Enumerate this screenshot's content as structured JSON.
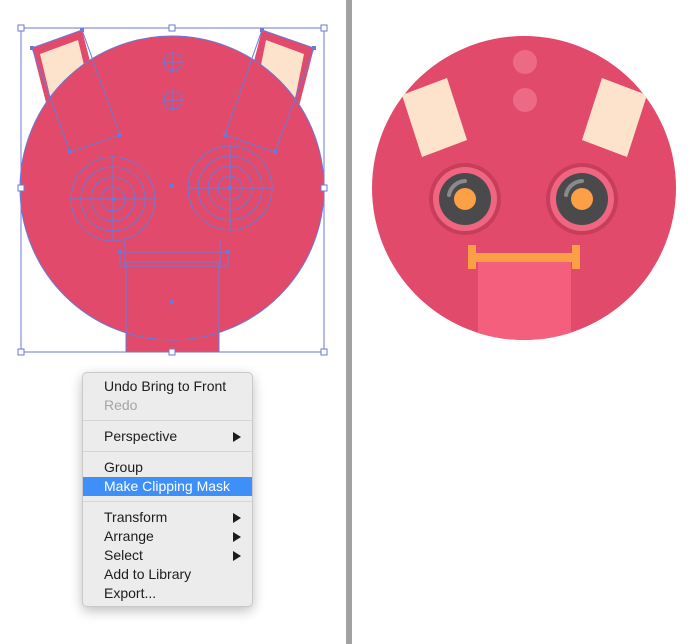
{
  "colors": {
    "face": "#e14a6a",
    "ear": "#fde3cc",
    "dot": "#ed6a86",
    "eye_ring": "#f06582",
    "eye_ring_dark": "#c63e5a",
    "pupil": "#4a4a4c",
    "iris": "#fca046",
    "mouth_bar": "#fca046",
    "tongue": "#f45f7e",
    "selection": "#6b79d8",
    "menu_highlight": "#3e8ff7"
  },
  "context_menu": {
    "items": [
      {
        "label": "Undo Bring to Front",
        "enabled": true,
        "submenu": false,
        "highlighted": false
      },
      {
        "label": "Redo",
        "enabled": false,
        "submenu": false,
        "highlighted": false
      },
      {
        "separator": true
      },
      {
        "label": "Perspective",
        "enabled": true,
        "submenu": true,
        "highlighted": false
      },
      {
        "separator": true
      },
      {
        "label": "Group",
        "enabled": true,
        "submenu": false,
        "highlighted": false
      },
      {
        "label": "Make Clipping Mask",
        "enabled": true,
        "submenu": false,
        "highlighted": true
      },
      {
        "separator": true
      },
      {
        "label": "Transform",
        "enabled": true,
        "submenu": true,
        "highlighted": false
      },
      {
        "label": "Arrange",
        "enabled": true,
        "submenu": true,
        "highlighted": false
      },
      {
        "label": "Select",
        "enabled": true,
        "submenu": true,
        "highlighted": false
      },
      {
        "label": "Add to Library",
        "enabled": true,
        "submenu": false,
        "highlighted": false
      },
      {
        "label": "Export...",
        "enabled": true,
        "submenu": false,
        "highlighted": false
      }
    ]
  }
}
